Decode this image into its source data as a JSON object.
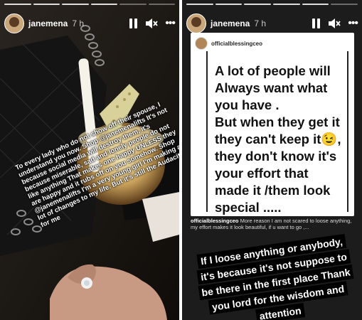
{
  "left_story": {
    "username": "janemena",
    "time": "7 h",
    "icons": {
      "pause": "pause-icon",
      "mute": "speaker-muted-icon",
      "more": "more-options-icon"
    },
    "overlay_text": "To every lady who do not show off their spouse, I understand you now. Shop @janemenalifts It's not because social media will destroy them, it's because miserable, sad and lonely people do not like anything That makes one happy UNLESS they are happy and it rubs off on you somehow. Shop @janemenalifts I'm a very young girl I'm making a lot of changes to my life. But it's still the Audacity for me"
  },
  "right_story": {
    "username": "janemena",
    "time": "7 h",
    "shared_post": {
      "username": "officialblessingceo",
      "quote_lines": [
        "A lot of people will",
        "Always want what",
        "you have .",
        "But when they get it",
        "they can't keep it",
        "they don't know it's",
        "your effort that",
        "made it /them look",
        "special ....."
      ],
      "quote_emoji": "😉",
      "caption_user": "officialblessingceo",
      "caption_text": "More reason I am not scared to loose anything, my effort makes it look beautiful, if u want to go ,..."
    },
    "sticker_text": "If I loose anything or anybody, it's because it's not suppose to be there in the first place Thank you lord for the wisdom and attention"
  }
}
